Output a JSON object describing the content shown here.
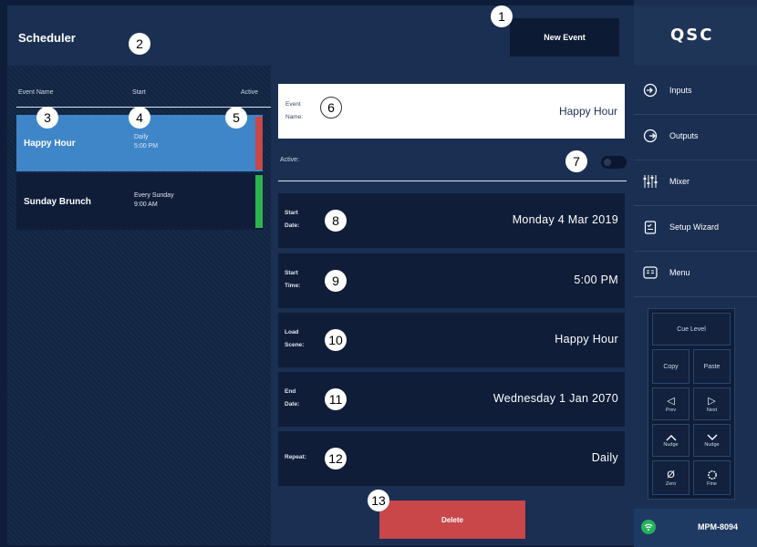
{
  "header": {
    "title": "Scheduler",
    "new_event_label": "New Event"
  },
  "list": {
    "columns": {
      "name": "Event Name",
      "start": "Start",
      "active": "Active"
    },
    "events": [
      {
        "name": "Happy Hour",
        "repeat": "Daily",
        "time": "5:00 PM",
        "active_color": "#c94649",
        "selected": true
      },
      {
        "name": "Sunday Brunch",
        "repeat": "Every Sunday",
        "time": "9:00 AM",
        "active_color": "#2eb24f",
        "selected": false
      }
    ]
  },
  "detail": {
    "event_name_label": "Event\nName:",
    "event_name_value": "Happy Hour",
    "active_label": "Active:",
    "active_value": false,
    "start_date_label": "Start\nDate:",
    "start_date_value": "Monday 4 Mar 2019",
    "start_time_label": "Start\nTime:",
    "start_time_value": "5:00 PM",
    "load_scene_label": "Load\nScene:",
    "load_scene_value": "Happy Hour",
    "end_date_label": "End\nDate:",
    "end_date_value": "Wednesday 1 Jan 2070",
    "repeat_label": "Repeat:",
    "repeat_value": "Daily",
    "delete_label": "Delete"
  },
  "callouts": [
    "1",
    "2",
    "3",
    "4",
    "5",
    "6",
    "7",
    "8",
    "9",
    "10",
    "11",
    "12",
    "13"
  ],
  "sidebar": {
    "logo": "QSC",
    "nav": [
      {
        "label": "Inputs",
        "icon": "inputs-icon"
      },
      {
        "label": "Outputs",
        "icon": "outputs-icon"
      },
      {
        "label": "Mixer",
        "icon": "mixer-icon"
      },
      {
        "label": "Setup Wizard",
        "icon": "setup-wizard-icon"
      },
      {
        "label": "Menu",
        "icon": "menu-icon"
      }
    ],
    "keypad": {
      "cue_level": "Cue Level",
      "copy": "Copy",
      "paste": "Paste",
      "prev": "Prev",
      "next": "Next",
      "nudge_up": "Nudge",
      "nudge_down": "Nudge",
      "zero": "Zero",
      "fine": "Fine"
    },
    "model": "MPM-8094"
  },
  "colors": {
    "accent_blue": "#3f86c9",
    "delete_red": "#c94649",
    "active_green": "#2eb24f",
    "wifi_green": "#22b35a"
  }
}
